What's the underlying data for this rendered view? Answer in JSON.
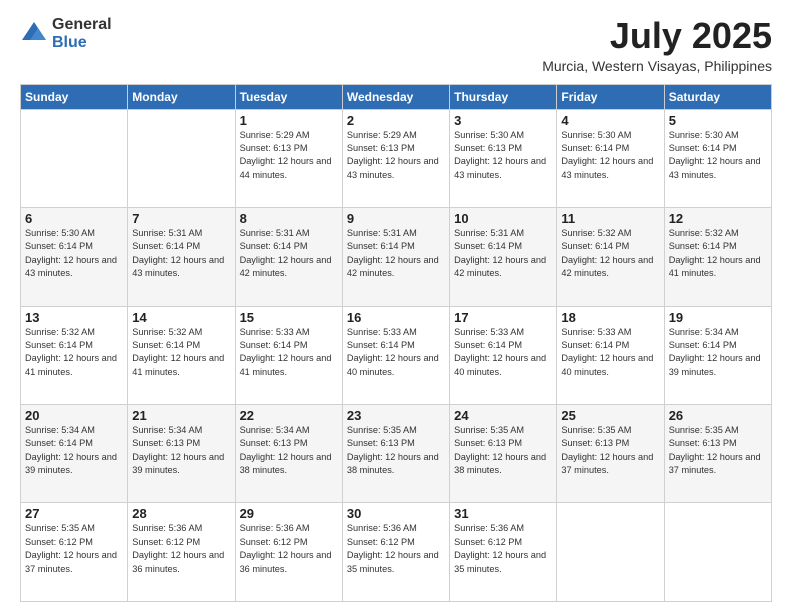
{
  "logo": {
    "general": "General",
    "blue": "Blue"
  },
  "title": "July 2025",
  "subtitle": "Murcia, Western Visayas, Philippines",
  "days_of_week": [
    "Sunday",
    "Monday",
    "Tuesday",
    "Wednesday",
    "Thursday",
    "Friday",
    "Saturday"
  ],
  "weeks": [
    [
      {
        "day": "",
        "info": ""
      },
      {
        "day": "",
        "info": ""
      },
      {
        "day": "1",
        "info": "Sunrise: 5:29 AM\nSunset: 6:13 PM\nDaylight: 12 hours and 44 minutes."
      },
      {
        "day": "2",
        "info": "Sunrise: 5:29 AM\nSunset: 6:13 PM\nDaylight: 12 hours and 43 minutes."
      },
      {
        "day": "3",
        "info": "Sunrise: 5:30 AM\nSunset: 6:13 PM\nDaylight: 12 hours and 43 minutes."
      },
      {
        "day": "4",
        "info": "Sunrise: 5:30 AM\nSunset: 6:14 PM\nDaylight: 12 hours and 43 minutes."
      },
      {
        "day": "5",
        "info": "Sunrise: 5:30 AM\nSunset: 6:14 PM\nDaylight: 12 hours and 43 minutes."
      }
    ],
    [
      {
        "day": "6",
        "info": "Sunrise: 5:30 AM\nSunset: 6:14 PM\nDaylight: 12 hours and 43 minutes."
      },
      {
        "day": "7",
        "info": "Sunrise: 5:31 AM\nSunset: 6:14 PM\nDaylight: 12 hours and 43 minutes."
      },
      {
        "day": "8",
        "info": "Sunrise: 5:31 AM\nSunset: 6:14 PM\nDaylight: 12 hours and 42 minutes."
      },
      {
        "day": "9",
        "info": "Sunrise: 5:31 AM\nSunset: 6:14 PM\nDaylight: 12 hours and 42 minutes."
      },
      {
        "day": "10",
        "info": "Sunrise: 5:31 AM\nSunset: 6:14 PM\nDaylight: 12 hours and 42 minutes."
      },
      {
        "day": "11",
        "info": "Sunrise: 5:32 AM\nSunset: 6:14 PM\nDaylight: 12 hours and 42 minutes."
      },
      {
        "day": "12",
        "info": "Sunrise: 5:32 AM\nSunset: 6:14 PM\nDaylight: 12 hours and 41 minutes."
      }
    ],
    [
      {
        "day": "13",
        "info": "Sunrise: 5:32 AM\nSunset: 6:14 PM\nDaylight: 12 hours and 41 minutes."
      },
      {
        "day": "14",
        "info": "Sunrise: 5:32 AM\nSunset: 6:14 PM\nDaylight: 12 hours and 41 minutes."
      },
      {
        "day": "15",
        "info": "Sunrise: 5:33 AM\nSunset: 6:14 PM\nDaylight: 12 hours and 41 minutes."
      },
      {
        "day": "16",
        "info": "Sunrise: 5:33 AM\nSunset: 6:14 PM\nDaylight: 12 hours and 40 minutes."
      },
      {
        "day": "17",
        "info": "Sunrise: 5:33 AM\nSunset: 6:14 PM\nDaylight: 12 hours and 40 minutes."
      },
      {
        "day": "18",
        "info": "Sunrise: 5:33 AM\nSunset: 6:14 PM\nDaylight: 12 hours and 40 minutes."
      },
      {
        "day": "19",
        "info": "Sunrise: 5:34 AM\nSunset: 6:14 PM\nDaylight: 12 hours and 39 minutes."
      }
    ],
    [
      {
        "day": "20",
        "info": "Sunrise: 5:34 AM\nSunset: 6:14 PM\nDaylight: 12 hours and 39 minutes."
      },
      {
        "day": "21",
        "info": "Sunrise: 5:34 AM\nSunset: 6:13 PM\nDaylight: 12 hours and 39 minutes."
      },
      {
        "day": "22",
        "info": "Sunrise: 5:34 AM\nSunset: 6:13 PM\nDaylight: 12 hours and 38 minutes."
      },
      {
        "day": "23",
        "info": "Sunrise: 5:35 AM\nSunset: 6:13 PM\nDaylight: 12 hours and 38 minutes."
      },
      {
        "day": "24",
        "info": "Sunrise: 5:35 AM\nSunset: 6:13 PM\nDaylight: 12 hours and 38 minutes."
      },
      {
        "day": "25",
        "info": "Sunrise: 5:35 AM\nSunset: 6:13 PM\nDaylight: 12 hours and 37 minutes."
      },
      {
        "day": "26",
        "info": "Sunrise: 5:35 AM\nSunset: 6:13 PM\nDaylight: 12 hours and 37 minutes."
      }
    ],
    [
      {
        "day": "27",
        "info": "Sunrise: 5:35 AM\nSunset: 6:12 PM\nDaylight: 12 hours and 37 minutes."
      },
      {
        "day": "28",
        "info": "Sunrise: 5:36 AM\nSunset: 6:12 PM\nDaylight: 12 hours and 36 minutes."
      },
      {
        "day": "29",
        "info": "Sunrise: 5:36 AM\nSunset: 6:12 PM\nDaylight: 12 hours and 36 minutes."
      },
      {
        "day": "30",
        "info": "Sunrise: 5:36 AM\nSunset: 6:12 PM\nDaylight: 12 hours and 35 minutes."
      },
      {
        "day": "31",
        "info": "Sunrise: 5:36 AM\nSunset: 6:12 PM\nDaylight: 12 hours and 35 minutes."
      },
      {
        "day": "",
        "info": ""
      },
      {
        "day": "",
        "info": ""
      }
    ]
  ]
}
